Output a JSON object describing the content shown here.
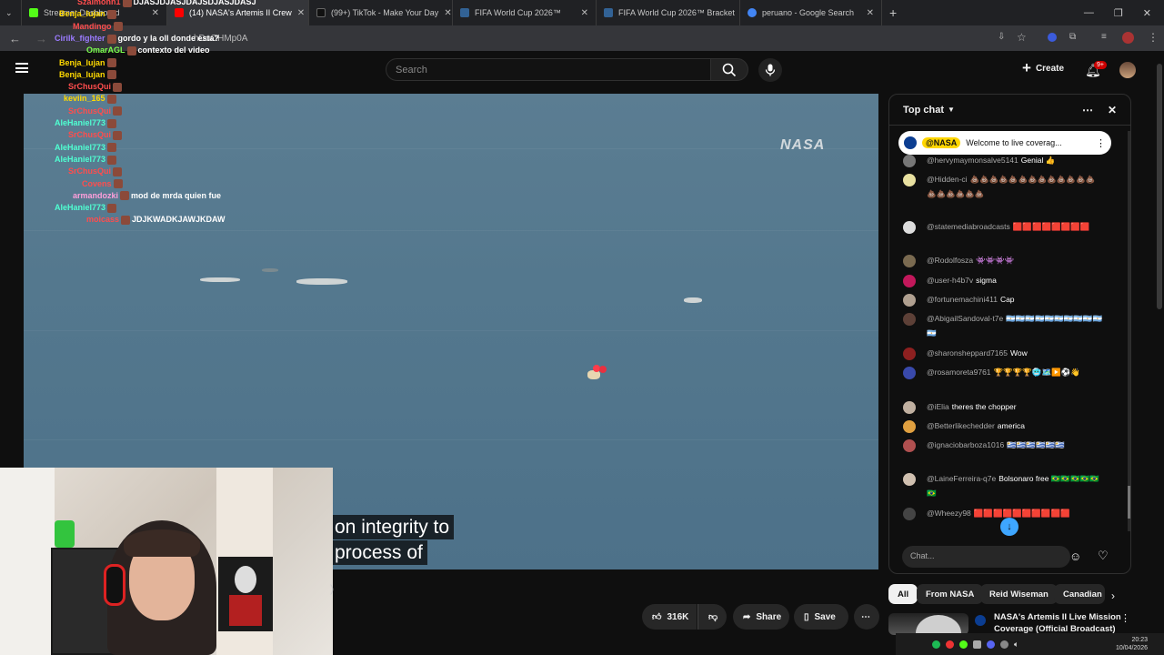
{
  "browser": {
    "tabs": [
      {
        "label": "Streamer Dashboard",
        "favicon_color": "#53fc18",
        "active": false
      },
      {
        "label": "(14) NASA's Artemis II Crew",
        "favicon_color": "#ff0000",
        "active": true
      },
      {
        "label": "(99+) TikTok - Make Your Day",
        "favicon_color": "#000000",
        "active": false
      },
      {
        "label": "FIFA World Cup 2026™",
        "favicon_color": "#326295",
        "active": false
      },
      {
        "label": "FIFA World Cup 2026™ Bracket",
        "favicon_color": "#326295",
        "active": false
      },
      {
        "label": "peruano - Google Search",
        "favicon_color": "#4285f4",
        "active": false
      }
    ],
    "url_fragment": "hDuOHMp0A"
  },
  "youtube": {
    "search_placeholder": "Search",
    "create_label": "Create",
    "notification_badge": "9+"
  },
  "video": {
    "watermark": "NASA",
    "caption_line1": "on integrity to",
    "caption_line2": "process of",
    "stray_char": ")"
  },
  "actions": {
    "likes": "316K",
    "share": "Share",
    "save": "Save"
  },
  "stream_chat_overlay": [
    {
      "user": "Szaimonn1",
      "color": "#ff4d4d",
      "text": "DJASJDJASJDAJSDJASJDASJ"
    },
    {
      "user": "Benja_lujan",
      "color": "#ffd900",
      "text": ""
    },
    {
      "user": "Mandingo",
      "color": "#ff4d4d",
      "text": ""
    },
    {
      "user": "Cirilk_fighter",
      "color": "#9b7bff",
      "text": "gordo y la oll donde esta?"
    },
    {
      "user": "OmarAGL",
      "color": "#7cff4f",
      "text": "contexto del video"
    },
    {
      "user": "Benja_lujan",
      "color": "#ffd900",
      "text": ""
    },
    {
      "user": "Benja_lujan",
      "color": "#ffd900",
      "text": ""
    },
    {
      "user": "SrChusQui",
      "color": "#ff4d4d",
      "text": ""
    },
    {
      "user": "keviin_165",
      "color": "#ffd900",
      "text": ""
    },
    {
      "user": "SrChusQui",
      "color": "#ff4d4d",
      "text": ""
    },
    {
      "user": "AleHaniel773",
      "color": "#4fffd2",
      "text": ""
    },
    {
      "user": "SrChusQui",
      "color": "#ff4d4d",
      "text": ""
    },
    {
      "user": "AleHaniel773",
      "color": "#4fffd2",
      "text": ""
    },
    {
      "user": "AleHaniel773",
      "color": "#4fffd2",
      "text": ""
    },
    {
      "user": "SrChusQui",
      "color": "#ff4d4d",
      "text": ""
    },
    {
      "user": "Covens",
      "color": "#ff4d4d",
      "text": ""
    },
    {
      "user": "armandozki",
      "color": "#ff9edb",
      "text": "mod de mrda quien fue"
    },
    {
      "user": "AleHaniel773",
      "color": "#4fffd2",
      "text": ""
    },
    {
      "user": "moicass",
      "color": "#ff4d4d",
      "text": "JDJKWADKJAWJKDAW"
    }
  ],
  "chat": {
    "header": "Top chat",
    "pinned_author": "@NASA",
    "pinned_text": "Welcome to live coverag...",
    "input_placeholder": "Chat...",
    "messages": [
      {
        "author": "@hervymaymonsalve5141",
        "text": "Genial 👍",
        "avatar_color": "#777777"
      },
      {
        "author": "@Hidden-ci",
        "text": "💩💩💩💩💩💩💩💩💩💩💩💩💩💩💩💩💩💩💩",
        "avatar_color": "#e8e0a0"
      },
      {
        "author": "@statemediabroadcasts",
        "text": "🟥🟥🟥🟥🟥🟥🟥🟥",
        "avatar_color": "#dddddd"
      },
      {
        "author": "@Rodolfosza",
        "text": "👾👾👾👾",
        "avatar_color": "#7a6a50"
      },
      {
        "author": "@user-h4b7v",
        "text": "sigma",
        "avatar_color": "#c2185b"
      },
      {
        "author": "@fortunemachini411",
        "text": "Cap",
        "avatar_color": "#b0a090"
      },
      {
        "author": "@AbigailSandoval-t7e",
        "text": "🇦🇷🇦🇷🇦🇷🇦🇷🇦🇷🇦🇷🇦🇷🇦🇷🇦🇷🇦🇷🇦🇷",
        "avatar_color": "#5d4037"
      },
      {
        "author": "@sharonsheppard7165",
        "text": "Wow",
        "avatar_color": "#8d2020"
      },
      {
        "author": "@rosamoreta9761",
        "text": "🏆🏆🏆🏆🥶🗺️▶️⚽👋",
        "avatar_color": "#3949ab"
      },
      {
        "author": "@iElia",
        "text": "theres the chopper",
        "avatar_color": "#c0b0a0"
      },
      {
        "author": "@Betterlikechedder",
        "text": "america",
        "avatar_color": "#e0a040"
      },
      {
        "author": "@ignaciobarboza1016",
        "text": "🇺🇾🇺🇾🇺🇾🇺🇾🇺🇾🇺🇾",
        "avatar_color": "#b05050"
      },
      {
        "author": "@LaineFerreira-q7e",
        "text": "Bolsonaro free 🇧🇷🇧🇷🇧🇷🇧🇷🇧🇷🇧🇷",
        "avatar_color": "#d0c0b0"
      },
      {
        "author": "@Wheezy98",
        "text": "🟥🟥🟥🟥🟥🟥🟥🟥🟥🟥",
        "avatar_color": "#444444"
      }
    ]
  },
  "chips": [
    "All",
    "From NASA",
    "Reid Wiseman",
    "Canadian"
  ],
  "recommended": {
    "title_line1": "NASA's Artemis II Live Mission",
    "title_line2": "Coverage (Official Broadcast)"
  },
  "taskbar": {
    "time": "20:23",
    "date": "10/04/2026"
  }
}
